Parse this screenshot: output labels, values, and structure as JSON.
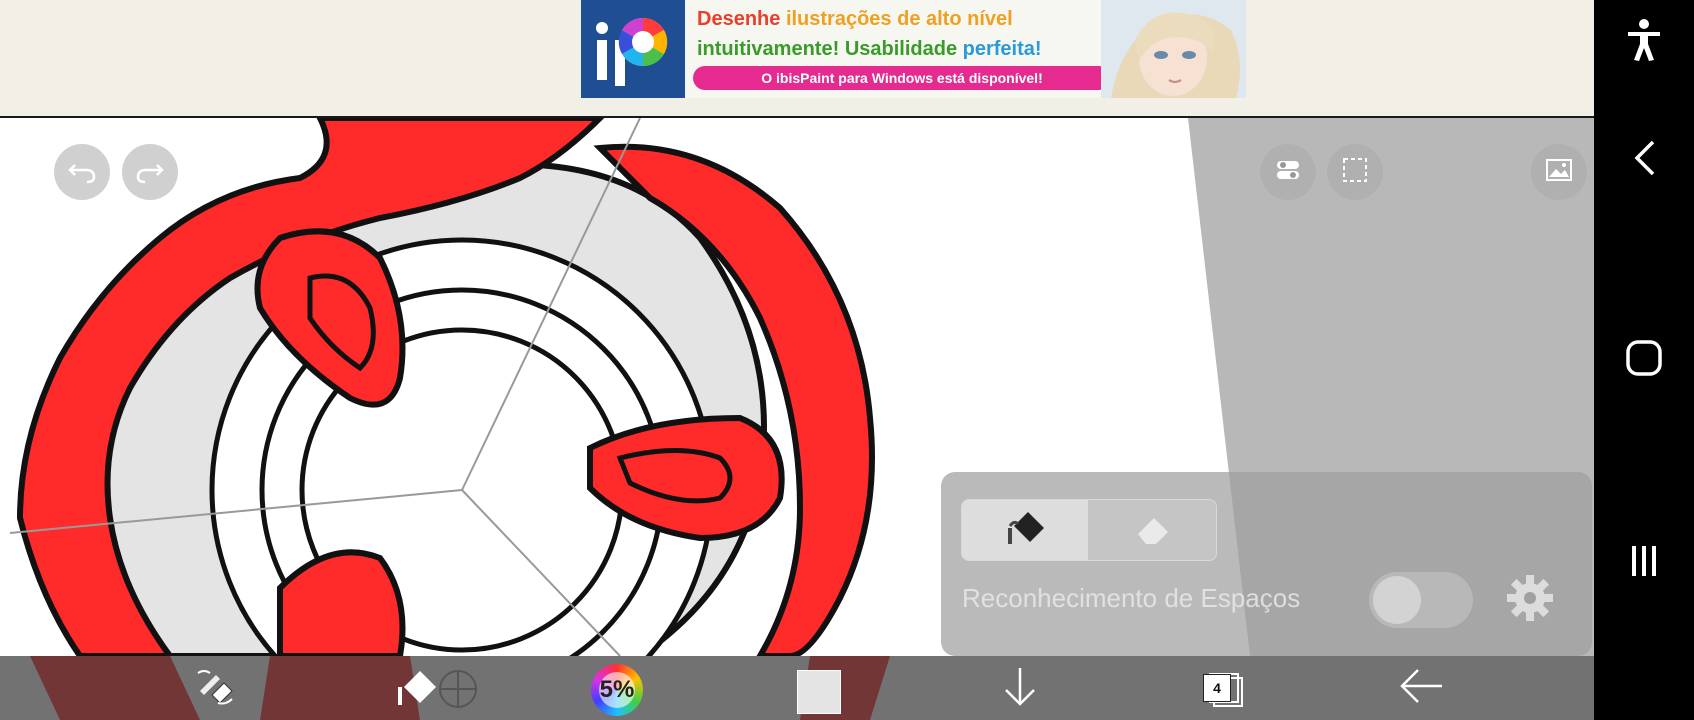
{
  "ad": {
    "line1_part1": "Desenhe",
    "line1_part2": "ilustrações de alto nível",
    "line2_part1": "intuitivamente!",
    "line2_part2": "Usabilidade",
    "line2_part3": "perfeita!",
    "pill_text": "O ibisPaint para Windows está disponível!",
    "logo_text": "iP",
    "colors": {
      "line1_a": "#e8402a",
      "line1_b": "#f0a020",
      "line2_a": "#3a9a2a",
      "line2_c": "#2a9ad8",
      "pill": "#e52b8f",
      "logo_bg": "#1f4e92"
    }
  },
  "canvas_controls": {
    "undo_icon": "undo-icon",
    "redo_icon": "redo-icon",
    "material_icon": "material-icon",
    "selection_icon": "selection-icon",
    "reference_icon": "image-icon"
  },
  "fill_panel": {
    "modes": [
      {
        "icon": "paint-bucket-icon",
        "selected": true
      },
      {
        "icon": "eraser-icon",
        "selected": false
      }
    ],
    "gap_recognition_label": "Reconhecimento de Espaços",
    "gap_recognition_on": false,
    "settings_icon": "gear-icon"
  },
  "toolbar": {
    "tool_icon": "pen-eraser-swap-icon",
    "fill_tool_icon": "fill-target-icon",
    "brush_opacity": "5%",
    "color_swatch": "#e4e4e4",
    "move_down_icon": "arrow-down-icon",
    "layers_count": "4",
    "back_icon": "arrow-left-icon"
  },
  "system_nav": {
    "accessibility_icon": "accessibility-icon",
    "back_icon": "chevron-left-icon",
    "home_icon": "home-icon",
    "recents_icon": "recents-icon"
  },
  "colors": {
    "art_red": "#ff2a2a",
    "art_outline": "#111111",
    "art_gray": "#e4e4e4"
  }
}
